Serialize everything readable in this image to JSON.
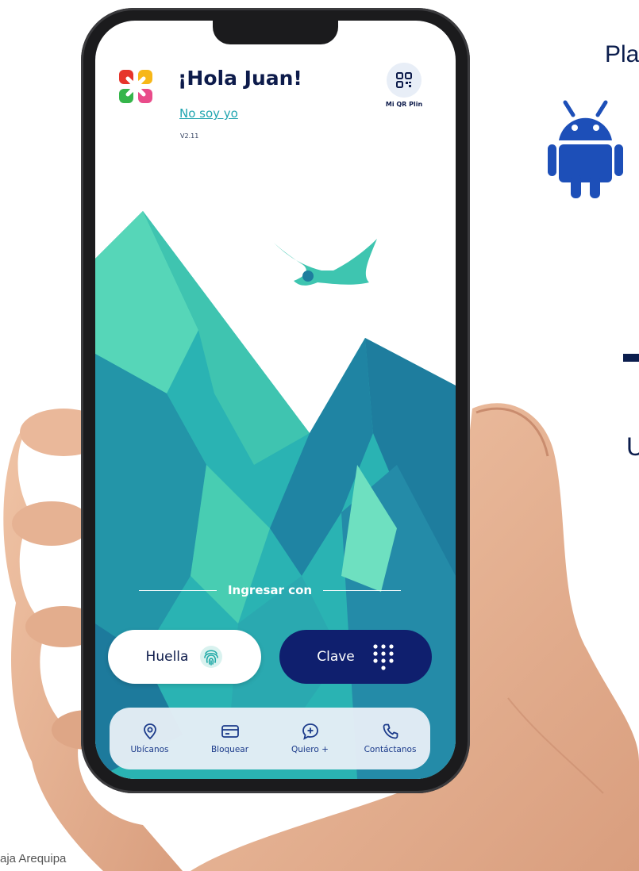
{
  "side": {
    "title": "Pla",
    "letter": "U"
  },
  "caption": "aja Arequipa",
  "header": {
    "greeting": "¡Hola Juan!",
    "not_me": "No soy yo",
    "version": "V2.11",
    "qr_label": "Mi QR Plin"
  },
  "login": {
    "ingresar_con": "Ingresar con",
    "huella_label": "Huella",
    "clave_label": "Clave"
  },
  "nav": [
    {
      "label": "Ubícanos",
      "icon": "location-pin-icon"
    },
    {
      "label": "Bloquear",
      "icon": "card-icon"
    },
    {
      "label": "Quiero +",
      "icon": "chat-plus-icon"
    },
    {
      "label": "Contáctanos",
      "icon": "phone-icon"
    }
  ],
  "colors": {
    "navy": "#0f1f6e",
    "teal_link": "#20a5b0",
    "android_blue": "#1d4fb8"
  }
}
